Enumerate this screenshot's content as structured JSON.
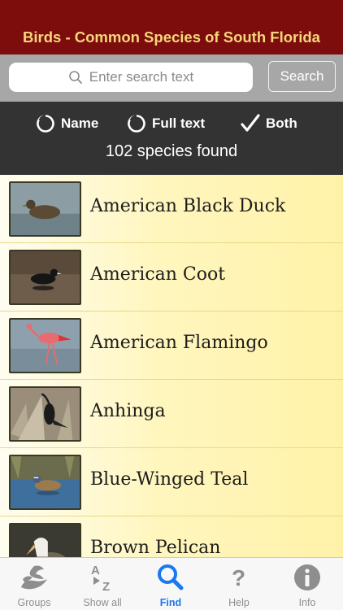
{
  "header": {
    "title": "Birds - Common Species of South Florida"
  },
  "search": {
    "placeholder": "Enter search text",
    "button_label": "Search"
  },
  "options": {
    "name_label": "Name",
    "fulltext_label": "Full text",
    "both_label": "Both",
    "selected": "Both",
    "count_text": "102 species found"
  },
  "species": [
    {
      "name": "American Black Duck"
    },
    {
      "name": "American Coot"
    },
    {
      "name": "American Flamingo"
    },
    {
      "name": "Anhinga"
    },
    {
      "name": "Blue-Winged Teal"
    },
    {
      "name": "Brown Pelican"
    }
  ],
  "tabs": [
    {
      "label": "Groups",
      "icon": "birds-icon",
      "active": false
    },
    {
      "label": "Show all",
      "icon": "a-z-sort-icon",
      "active": false
    },
    {
      "label": "Find",
      "icon": "search-icon",
      "active": true
    },
    {
      "label": "Help",
      "icon": "question-icon",
      "active": false
    },
    {
      "label": "Info",
      "icon": "info-icon",
      "active": false
    }
  ],
  "colors": {
    "header_bg": "#7d0d0d",
    "header_text": "#f6d77a",
    "active_tab": "#1a78f0"
  }
}
